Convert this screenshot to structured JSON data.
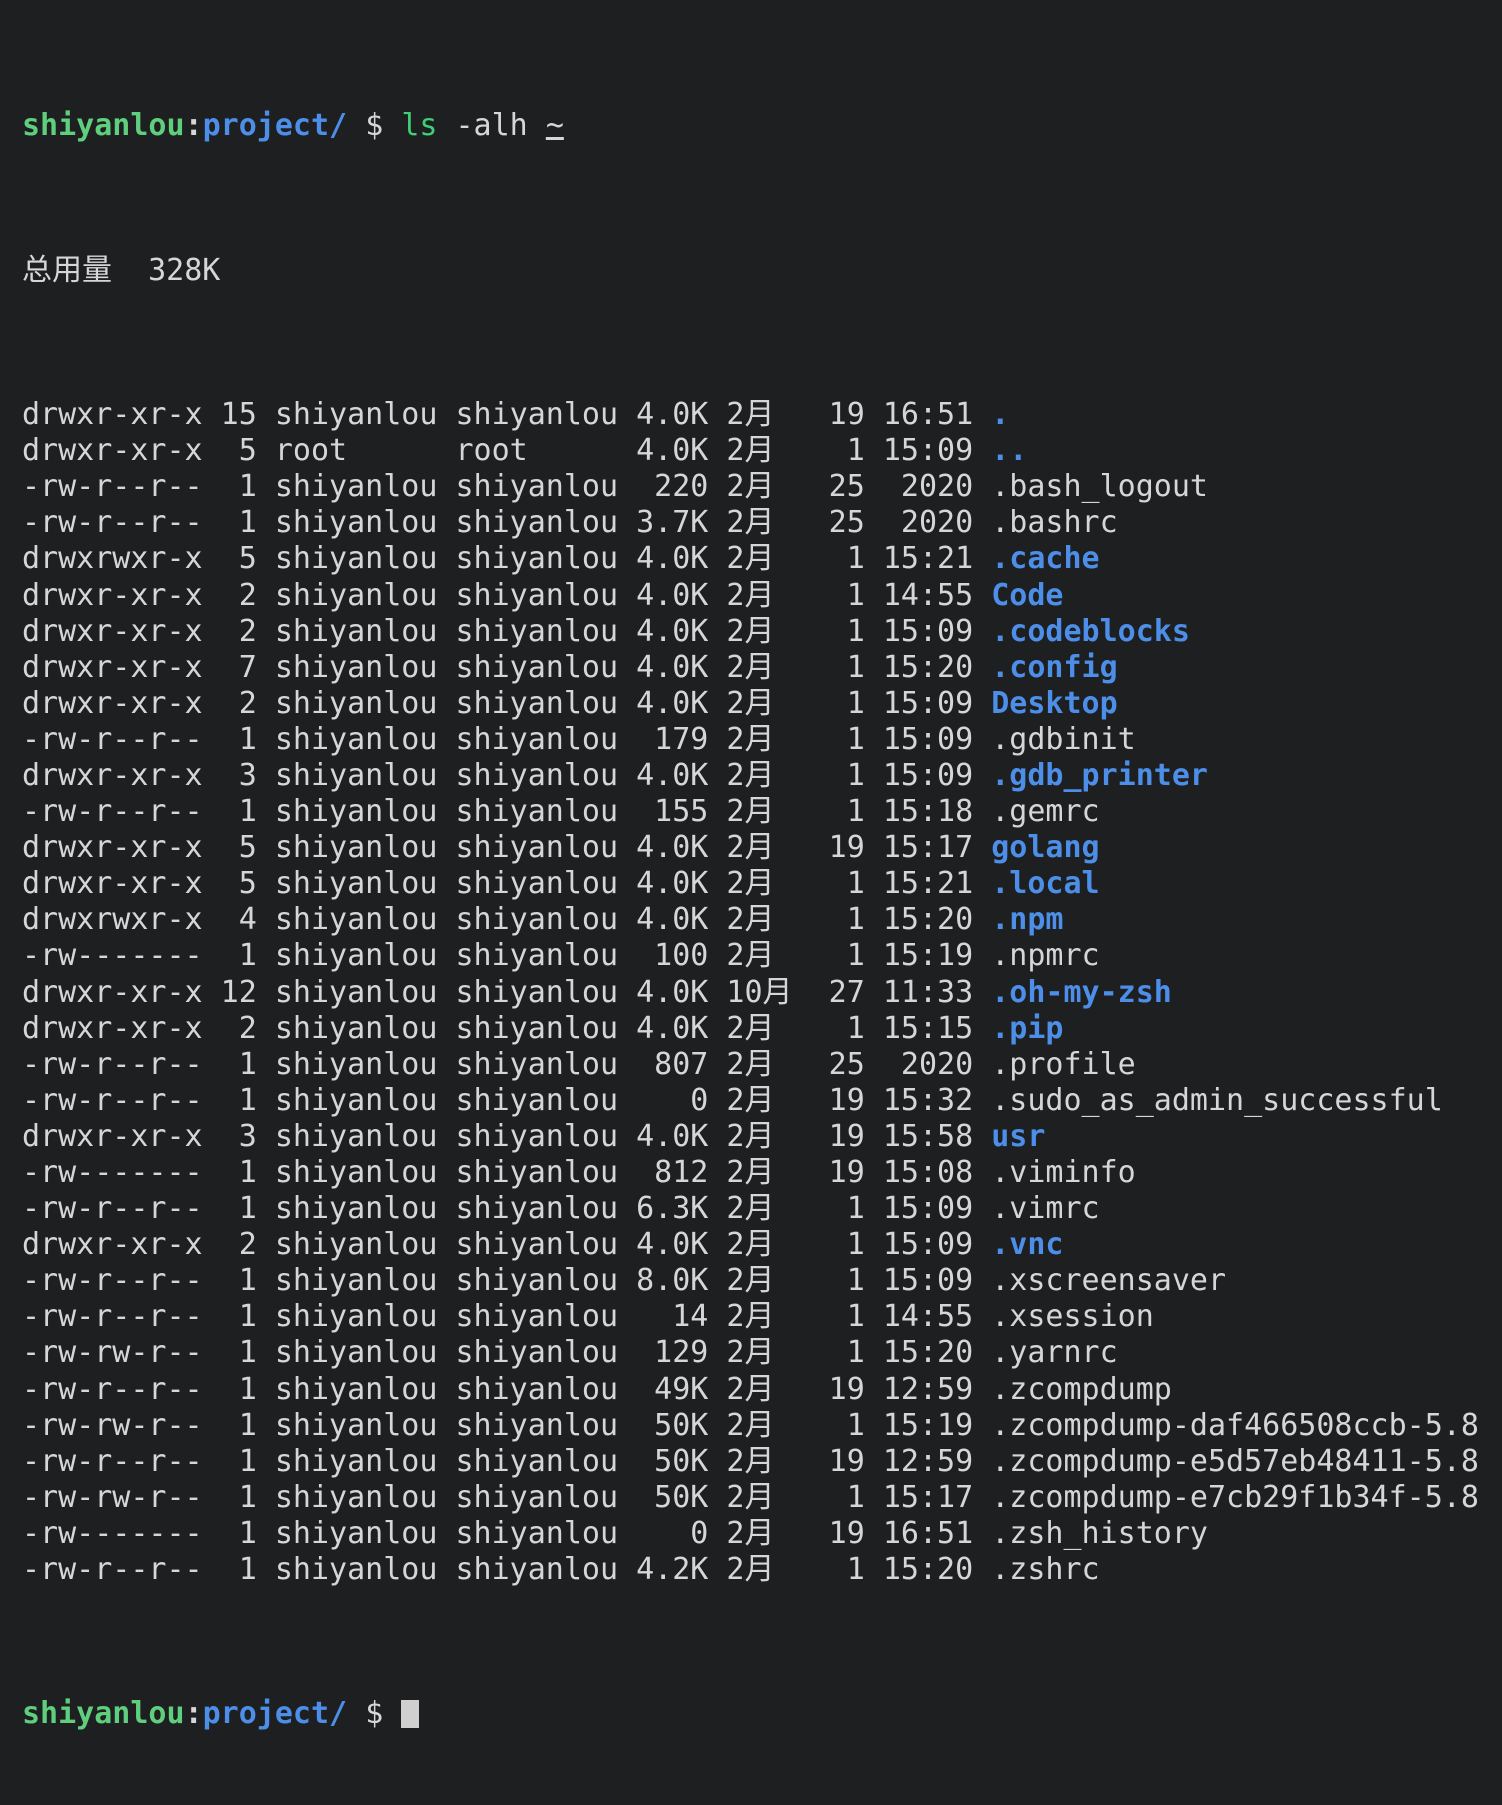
{
  "terminal": {
    "colors": {
      "background": "#1d1f21",
      "foreground": "#d6d6d6",
      "prompt_user": "#5fce7d",
      "prompt_path": "#4c8ee8",
      "command": "#3fcf77",
      "directory": "#4c8ee8",
      "cursor": "#cfcfcf"
    },
    "prompt": {
      "user": "shiyanlou",
      "separator": ":",
      "path": "project/",
      "symbol": "$"
    },
    "command_line": {
      "command": "ls",
      "flags": "-alh",
      "target": "~"
    },
    "total_line": "总用量  328K",
    "columns": [
      "permissions",
      "links",
      "owner",
      "group",
      "size",
      "month",
      "day",
      "time",
      "name"
    ],
    "entries": [
      {
        "perm": "drwxr-xr-x",
        "links": "15",
        "owner": "shiyanlou",
        "group": "shiyanlou",
        "size": "4.0K",
        "month": "2月",
        "day": "19",
        "time": "16:51",
        "name": ".",
        "dir": true
      },
      {
        "perm": "drwxr-xr-x",
        "links": "5",
        "owner": "root",
        "group": "root",
        "size": "4.0K",
        "month": "2月",
        "day": "1",
        "time": "15:09",
        "name": "..",
        "dir": true
      },
      {
        "perm": "-rw-r--r--",
        "links": "1",
        "owner": "shiyanlou",
        "group": "shiyanlou",
        "size": "220",
        "month": "2月",
        "day": "25",
        "time": "2020",
        "name": ".bash_logout",
        "dir": false
      },
      {
        "perm": "-rw-r--r--",
        "links": "1",
        "owner": "shiyanlou",
        "group": "shiyanlou",
        "size": "3.7K",
        "month": "2月",
        "day": "25",
        "time": "2020",
        "name": ".bashrc",
        "dir": false
      },
      {
        "perm": "drwxrwxr-x",
        "links": "5",
        "owner": "shiyanlou",
        "group": "shiyanlou",
        "size": "4.0K",
        "month": "2月",
        "day": "1",
        "time": "15:21",
        "name": ".cache",
        "dir": true
      },
      {
        "perm": "drwxr-xr-x",
        "links": "2",
        "owner": "shiyanlou",
        "group": "shiyanlou",
        "size": "4.0K",
        "month": "2月",
        "day": "1",
        "time": "14:55",
        "name": "Code",
        "dir": true
      },
      {
        "perm": "drwxr-xr-x",
        "links": "2",
        "owner": "shiyanlou",
        "group": "shiyanlou",
        "size": "4.0K",
        "month": "2月",
        "day": "1",
        "time": "15:09",
        "name": ".codeblocks",
        "dir": true
      },
      {
        "perm": "drwxr-xr-x",
        "links": "7",
        "owner": "shiyanlou",
        "group": "shiyanlou",
        "size": "4.0K",
        "month": "2月",
        "day": "1",
        "time": "15:20",
        "name": ".config",
        "dir": true
      },
      {
        "perm": "drwxr-xr-x",
        "links": "2",
        "owner": "shiyanlou",
        "group": "shiyanlou",
        "size": "4.0K",
        "month": "2月",
        "day": "1",
        "time": "15:09",
        "name": "Desktop",
        "dir": true
      },
      {
        "perm": "-rw-r--r--",
        "links": "1",
        "owner": "shiyanlou",
        "group": "shiyanlou",
        "size": "179",
        "month": "2月",
        "day": "1",
        "time": "15:09",
        "name": ".gdbinit",
        "dir": false
      },
      {
        "perm": "drwxr-xr-x",
        "links": "3",
        "owner": "shiyanlou",
        "group": "shiyanlou",
        "size": "4.0K",
        "month": "2月",
        "day": "1",
        "time": "15:09",
        "name": ".gdb_printer",
        "dir": true
      },
      {
        "perm": "-rw-r--r--",
        "links": "1",
        "owner": "shiyanlou",
        "group": "shiyanlou",
        "size": "155",
        "month": "2月",
        "day": "1",
        "time": "15:18",
        "name": ".gemrc",
        "dir": false
      },
      {
        "perm": "drwxr-xr-x",
        "links": "5",
        "owner": "shiyanlou",
        "group": "shiyanlou",
        "size": "4.0K",
        "month": "2月",
        "day": "19",
        "time": "15:17",
        "name": "golang",
        "dir": true
      },
      {
        "perm": "drwxr-xr-x",
        "links": "5",
        "owner": "shiyanlou",
        "group": "shiyanlou",
        "size": "4.0K",
        "month": "2月",
        "day": "1",
        "time": "15:21",
        "name": ".local",
        "dir": true
      },
      {
        "perm": "drwxrwxr-x",
        "links": "4",
        "owner": "shiyanlou",
        "group": "shiyanlou",
        "size": "4.0K",
        "month": "2月",
        "day": "1",
        "time": "15:20",
        "name": ".npm",
        "dir": true
      },
      {
        "perm": "-rw-------",
        "links": "1",
        "owner": "shiyanlou",
        "group": "shiyanlou",
        "size": "100",
        "month": "2月",
        "day": "1",
        "time": "15:19",
        "name": ".npmrc",
        "dir": false
      },
      {
        "perm": "drwxr-xr-x",
        "links": "12",
        "owner": "shiyanlou",
        "group": "shiyanlou",
        "size": "4.0K",
        "month": "10月",
        "day": "27",
        "time": "11:33",
        "name": ".oh-my-zsh",
        "dir": true
      },
      {
        "perm": "drwxr-xr-x",
        "links": "2",
        "owner": "shiyanlou",
        "group": "shiyanlou",
        "size": "4.0K",
        "month": "2月",
        "day": "1",
        "time": "15:15",
        "name": ".pip",
        "dir": true
      },
      {
        "perm": "-rw-r--r--",
        "links": "1",
        "owner": "shiyanlou",
        "group": "shiyanlou",
        "size": "807",
        "month": "2月",
        "day": "25",
        "time": "2020",
        "name": ".profile",
        "dir": false
      },
      {
        "perm": "-rw-r--r--",
        "links": "1",
        "owner": "shiyanlou",
        "group": "shiyanlou",
        "size": "0",
        "month": "2月",
        "day": "19",
        "time": "15:32",
        "name": ".sudo_as_admin_successful",
        "dir": false
      },
      {
        "perm": "drwxr-xr-x",
        "links": "3",
        "owner": "shiyanlou",
        "group": "shiyanlou",
        "size": "4.0K",
        "month": "2月",
        "day": "19",
        "time": "15:58",
        "name": "usr",
        "dir": true
      },
      {
        "perm": "-rw-------",
        "links": "1",
        "owner": "shiyanlou",
        "group": "shiyanlou",
        "size": "812",
        "month": "2月",
        "day": "19",
        "time": "15:08",
        "name": ".viminfo",
        "dir": false
      },
      {
        "perm": "-rw-r--r--",
        "links": "1",
        "owner": "shiyanlou",
        "group": "shiyanlou",
        "size": "6.3K",
        "month": "2月",
        "day": "1",
        "time": "15:09",
        "name": ".vimrc",
        "dir": false
      },
      {
        "perm": "drwxr-xr-x",
        "links": "2",
        "owner": "shiyanlou",
        "group": "shiyanlou",
        "size": "4.0K",
        "month": "2月",
        "day": "1",
        "time": "15:09",
        "name": ".vnc",
        "dir": true
      },
      {
        "perm": "-rw-r--r--",
        "links": "1",
        "owner": "shiyanlou",
        "group": "shiyanlou",
        "size": "8.0K",
        "month": "2月",
        "day": "1",
        "time": "15:09",
        "name": ".xscreensaver",
        "dir": false
      },
      {
        "perm": "-rw-r--r--",
        "links": "1",
        "owner": "shiyanlou",
        "group": "shiyanlou",
        "size": "14",
        "month": "2月",
        "day": "1",
        "time": "14:55",
        "name": ".xsession",
        "dir": false
      },
      {
        "perm": "-rw-rw-r--",
        "links": "1",
        "owner": "shiyanlou",
        "group": "shiyanlou",
        "size": "129",
        "month": "2月",
        "day": "1",
        "time": "15:20",
        "name": ".yarnrc",
        "dir": false
      },
      {
        "perm": "-rw-r--r--",
        "links": "1",
        "owner": "shiyanlou",
        "group": "shiyanlou",
        "size": "49K",
        "month": "2月",
        "day": "19",
        "time": "12:59",
        "name": ".zcompdump",
        "dir": false
      },
      {
        "perm": "-rw-rw-r--",
        "links": "1",
        "owner": "shiyanlou",
        "group": "shiyanlou",
        "size": "50K",
        "month": "2月",
        "day": "1",
        "time": "15:19",
        "name": ".zcompdump-daf466508ccb-5.8",
        "dir": false
      },
      {
        "perm": "-rw-r--r--",
        "links": "1",
        "owner": "shiyanlou",
        "group": "shiyanlou",
        "size": "50K",
        "month": "2月",
        "day": "19",
        "time": "12:59",
        "name": ".zcompdump-e5d57eb48411-5.8",
        "dir": false
      },
      {
        "perm": "-rw-rw-r--",
        "links": "1",
        "owner": "shiyanlou",
        "group": "shiyanlou",
        "size": "50K",
        "month": "2月",
        "day": "1",
        "time": "15:17",
        "name": ".zcompdump-e7cb29f1b34f-5.8",
        "dir": false
      },
      {
        "perm": "-rw-------",
        "links": "1",
        "owner": "shiyanlou",
        "group": "shiyanlou",
        "size": "0",
        "month": "2月",
        "day": "19",
        "time": "16:51",
        "name": ".zsh_history",
        "dir": false
      },
      {
        "perm": "-rw-r--r--",
        "links": "1",
        "owner": "shiyanlou",
        "group": "shiyanlou",
        "size": "4.2K",
        "month": "2月",
        "day": "1",
        "time": "15:20",
        "name": ".zshrc",
        "dir": false
      }
    ]
  }
}
